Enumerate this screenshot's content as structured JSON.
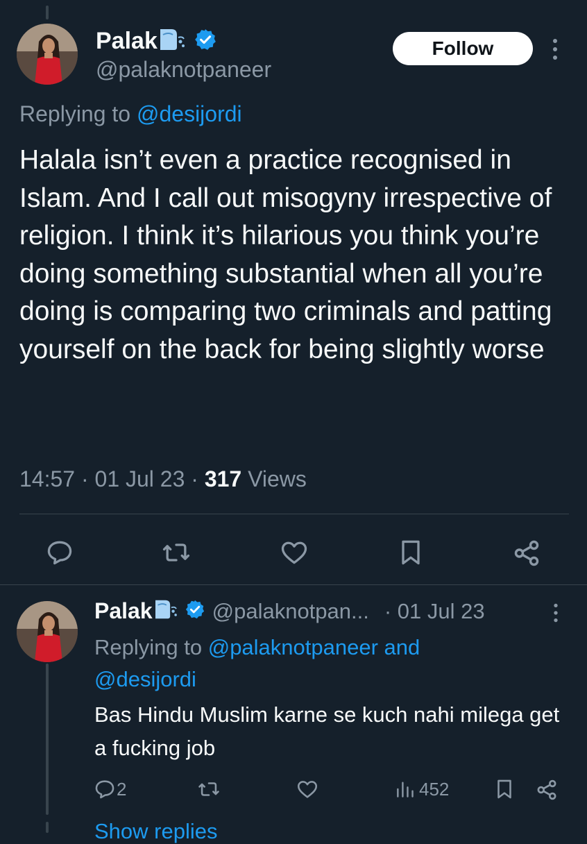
{
  "tweet": {
    "display_name": "Palak",
    "handle": "@palaknotpaneer",
    "follow_label": "Follow",
    "replying_prefix": "Replying to",
    "replying_to": "@desijordi",
    "text": "Halala isn’t even a practice recognised in Islam. And I call out misogyny irrespective of religion. I think it’s hilarious you think you’re doing something substantial when all you’re doing is comparing two criminals and patting yourself on the back for being slightly worse",
    "time": "14:57",
    "date": "01 Jul 23",
    "views_count": "317",
    "views_label": "Views",
    "separator": "·"
  },
  "reply": {
    "display_name": "Palak",
    "handle": "@palaknotpan...",
    "date": "· 01 Jul 23",
    "replying_prefix": "Replying to",
    "replying_to_1": "@palaknotpaneer and",
    "replying_to_2": "@desijordi",
    "text": "Bas Hindu Muslim karne se kuch nahi milega get a fucking job",
    "reply_count": "2",
    "views_count": "452"
  },
  "show_replies_label": "Show replies",
  "icons": {
    "verified": "verified-badge-icon",
    "emoji": "wind-face-emoji-icon",
    "more": "more-dots-icon",
    "reply": "reply-icon",
    "retweet": "retweet-icon",
    "like": "heart-icon",
    "bookmark": "bookmark-icon",
    "share": "share-icon",
    "views": "views-icon"
  },
  "colors": {
    "background": "#15202b",
    "accent": "#1d9bf0",
    "muted": "#8b98a5",
    "text": "#f7f9f9"
  }
}
